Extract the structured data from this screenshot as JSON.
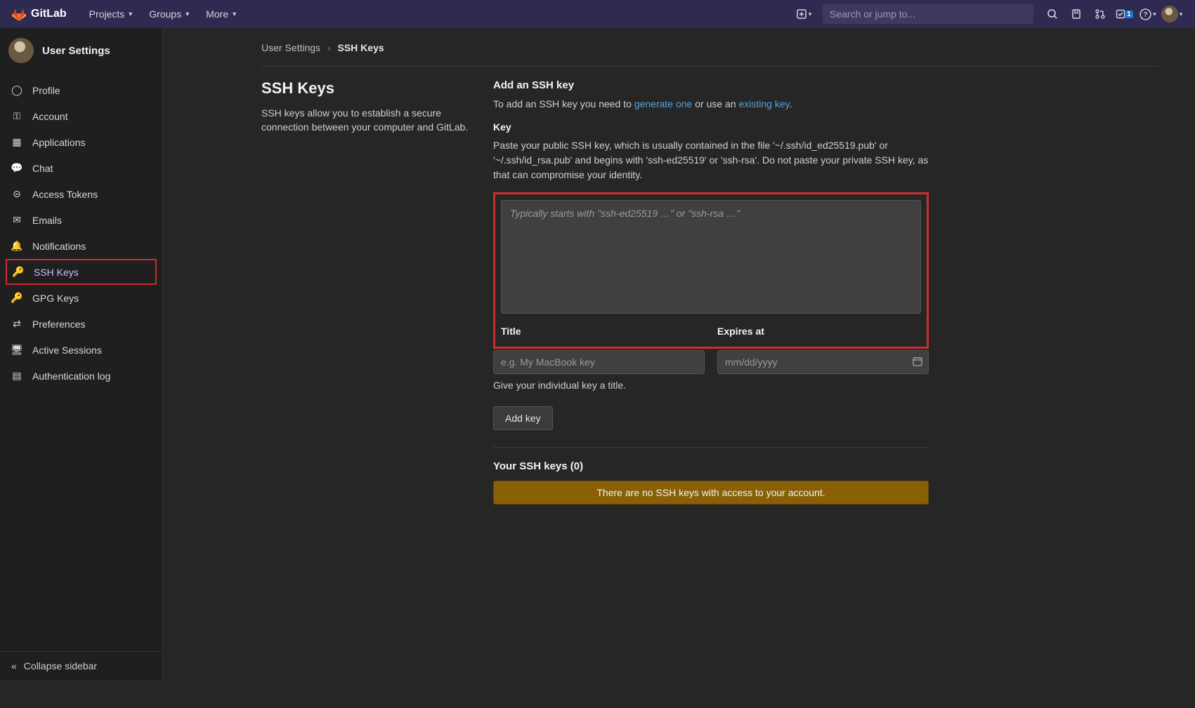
{
  "topnav": {
    "brand": "GitLab",
    "items": [
      "Projects",
      "Groups",
      "More"
    ],
    "search_placeholder": "Search or jump to...",
    "todo_count": "1"
  },
  "sidebar": {
    "title": "User Settings",
    "items": [
      {
        "icon": "user-icon",
        "glyph": "◯",
        "label": "Profile"
      },
      {
        "icon": "account-icon",
        "glyph": "⚿",
        "label": "Account"
      },
      {
        "icon": "apps-icon",
        "glyph": "▦",
        "label": "Applications"
      },
      {
        "icon": "chat-icon",
        "glyph": "💬",
        "label": "Chat"
      },
      {
        "icon": "token-icon",
        "glyph": "⊝",
        "label": "Access Tokens"
      },
      {
        "icon": "emails-icon",
        "glyph": "✉",
        "label": "Emails"
      },
      {
        "icon": "bell-icon",
        "glyph": "🔔",
        "label": "Notifications"
      },
      {
        "icon": "key-icon",
        "glyph": "🔑",
        "label": "SSH Keys",
        "active": true
      },
      {
        "icon": "key-icon",
        "glyph": "🔑",
        "label": "GPG Keys"
      },
      {
        "icon": "sliders-icon",
        "glyph": "⇄",
        "label": "Preferences"
      },
      {
        "icon": "monitor-icon",
        "glyph": "🖥",
        "label": "Active Sessions"
      },
      {
        "icon": "doc-icon",
        "glyph": "▤",
        "label": "Authentication log"
      }
    ],
    "collapse": "Collapse sidebar"
  },
  "breadcrumbs": {
    "root": "User Settings",
    "current": "SSH Keys"
  },
  "left": {
    "title": "SSH Keys",
    "desc": "SSH keys allow you to establish a secure connection between your computer and GitLab."
  },
  "form": {
    "add_head": "Add an SSH key",
    "add_text_pre": "To add an SSH key you need to ",
    "link_gen": "generate one",
    "add_text_mid": " or use an ",
    "link_exist": "existing key",
    "add_text_post": ".",
    "key_label": "Key",
    "key_help": "Paste your public SSH key, which is usually contained in the file '~/.ssh/id_ed25519.pub' or '~/.ssh/id_rsa.pub' and begins with 'ssh-ed25519' or 'ssh-rsa'. Do not paste your private SSH key, as that can compromise your identity.",
    "key_placeholder": "Typically starts with \"ssh-ed25519 …\" or \"ssh-rsa …\"",
    "title_label": "Title",
    "title_placeholder": "e.g. My MacBook key",
    "expires_label": "Expires at",
    "expires_placeholder": "mm/dd/yyyy",
    "title_hint": "Give your individual key a title.",
    "add_btn": "Add key"
  },
  "list": {
    "head": "Your SSH keys (0)",
    "empty": "There are no SSH keys with access to your account."
  }
}
